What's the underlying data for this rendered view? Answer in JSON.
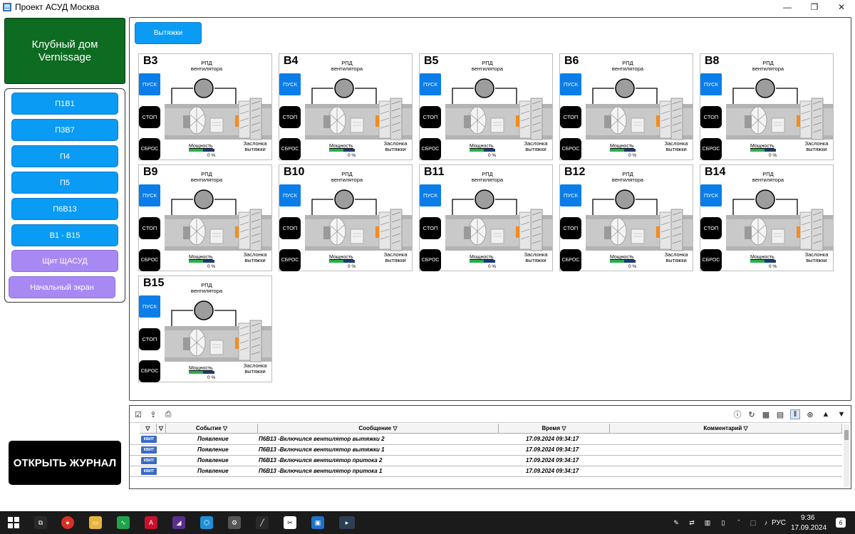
{
  "window": {
    "title": "Проект АСУД Москва",
    "minimize": "—",
    "maximize": "❐",
    "close": "✕"
  },
  "brand": {
    "line1": "Клубный дом",
    "line2": "Vernissage"
  },
  "nav": {
    "items": [
      {
        "label": "П1В1",
        "style": "blue"
      },
      {
        "label": "П3В7",
        "style": "blue"
      },
      {
        "label": "П4",
        "style": "blue"
      },
      {
        "label": "П5",
        "style": "blue"
      },
      {
        "label": "П6В13",
        "style": "blue"
      },
      {
        "label": "В1 - В15",
        "style": "blue"
      },
      {
        "label": "Щит ЩАСУД",
        "style": "purple"
      },
      {
        "label": "Начальный экран",
        "style": "purple"
      }
    ],
    "open_journal": "ОТКРЫТЬ ЖУРНАЛ"
  },
  "main": {
    "tab": "Вытяжки",
    "unit_labels": {
      "rpd": "РПД вентилятора",
      "start": "ПУСК",
      "stop": "СТОП",
      "reset": "СБРОС",
      "power": "Мощность",
      "damper": "Заслонка вытяжки"
    },
    "units": [
      {
        "name": "В3",
        "power": "0 %",
        "power_fraction": 0.55
      },
      {
        "name": "В4",
        "power": "0 %",
        "power_fraction": 0.55
      },
      {
        "name": "В5",
        "power": "0 %",
        "power_fraction": 0.55
      },
      {
        "name": "В6",
        "power": "0 %",
        "power_fraction": 0.55
      },
      {
        "name": "В8",
        "power": "0 %",
        "power_fraction": 0.55
      },
      {
        "name": "В9",
        "power": "0 %",
        "power_fraction": 0.55
      },
      {
        "name": "В10",
        "power": "0 %",
        "power_fraction": 0.55
      },
      {
        "name": "В11",
        "power": "0 %",
        "power_fraction": 0.55
      },
      {
        "name": "В12",
        "power": "0 %",
        "power_fraction": 0.55
      },
      {
        "name": "В14",
        "power": "0 %",
        "power_fraction": 0.55
      },
      {
        "name": "В15",
        "power": "0 %",
        "power_fraction": 0.55
      }
    ]
  },
  "journal": {
    "columns": [
      "Событие",
      "Сообщение",
      "Время",
      "Комментарий"
    ],
    "ack_label": "КВИТ",
    "rows": [
      {
        "event": "Появление",
        "message": "П6В13 -Включился вентилятор вытяжки 2",
        "time": "17.09.2024 09:34:17"
      },
      {
        "event": "Появление",
        "message": "П6В13 -Включился вентилятор вытяжки 1",
        "time": "17.09.2024 09:34:17"
      },
      {
        "event": "Появление",
        "message": "П6В13 -Включился вентилятор притока 2",
        "time": "17.09.2024 09:34:17"
      },
      {
        "event": "Появление",
        "message": "П6В13 -Включился вентилятор притока 1",
        "time": "17.09.2024 09:34:17"
      }
    ]
  },
  "taskbar": {
    "lang": "РУС",
    "time": "9:36",
    "date": "17.09.2024",
    "notifications": "6"
  }
}
